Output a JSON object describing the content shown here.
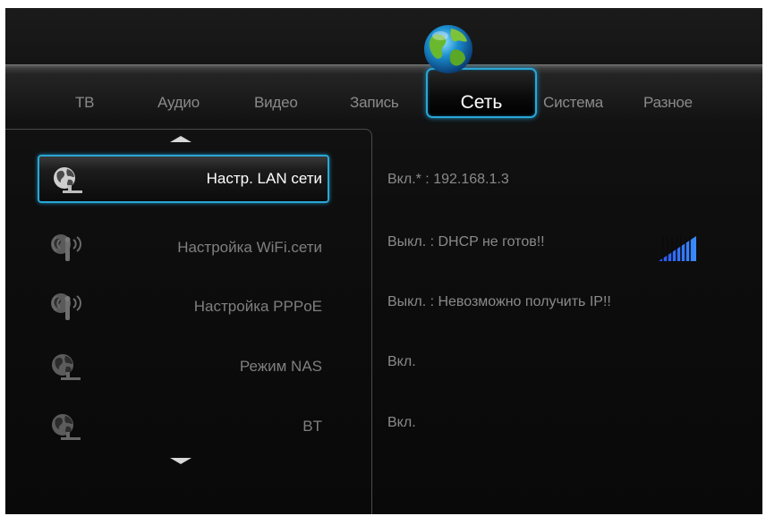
{
  "tabs": [
    {
      "label": "ТВ",
      "active": false
    },
    {
      "label": "Аудио",
      "active": false
    },
    {
      "label": "Видео",
      "active": false
    },
    {
      "label": "Запись",
      "active": false
    },
    {
      "label": "Сеть",
      "active": true
    },
    {
      "label": "Система",
      "active": false
    },
    {
      "label": "Разное",
      "active": false
    }
  ],
  "menu": [
    {
      "label": "Настр. LAN сети",
      "icon": "lan-globe-icon",
      "selected": true
    },
    {
      "label": "Настройка WiFi.сети",
      "icon": "wifi-antenna-icon",
      "selected": false
    },
    {
      "label": "Настройка PPPoE",
      "icon": "wifi-antenna-icon",
      "selected": false
    },
    {
      "label": "Режим NAS",
      "icon": "lan-globe-icon",
      "selected": false
    },
    {
      "label": "BT",
      "icon": "lan-globe-icon",
      "selected": false
    }
  ],
  "status": [
    "Вкл.* : 192.168.1.3",
    "Выкл. : DHCP не готов!!",
    "Выкл. : Невозможно получить IP!!",
    "Вкл.",
    "Вкл."
  ],
  "wifi_signal_icon": "signal-strength-icon",
  "colors": {
    "accent": "#29a7d6",
    "background": "#0e0e0e",
    "text_dim": "#8a8a8a",
    "text_active": "#ffffff"
  }
}
